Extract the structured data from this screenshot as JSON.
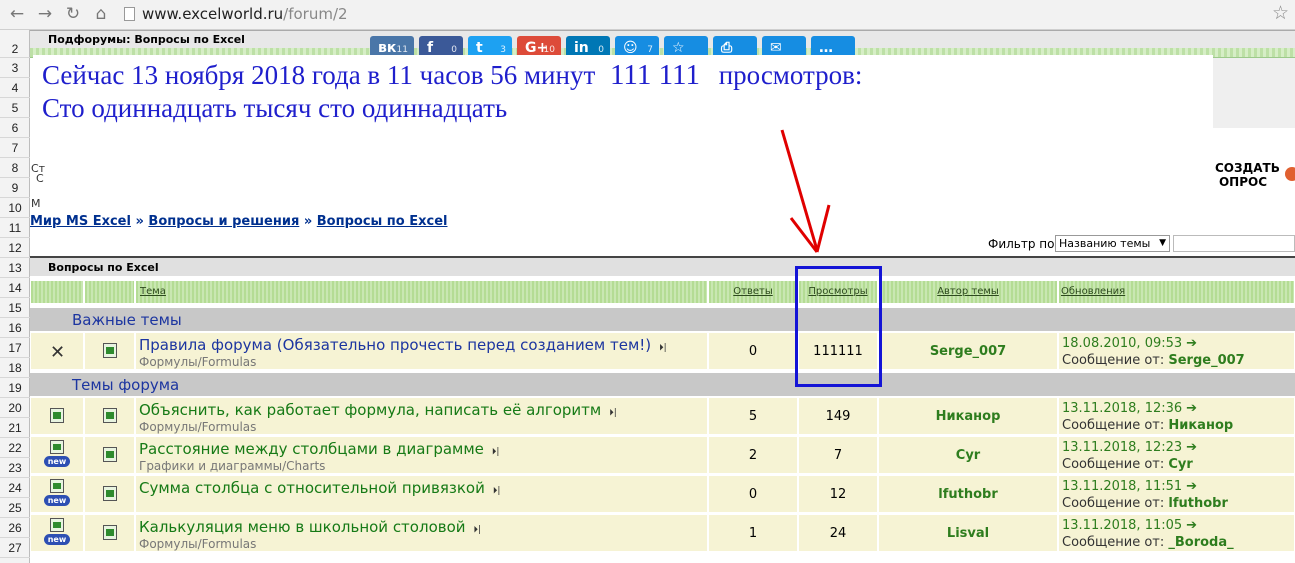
{
  "browser": {
    "url_host": "www.excelworld.ru",
    "url_path": "/forum/2"
  },
  "row_numbers": [
    "2",
    "3",
    "4",
    "5",
    "6",
    "7",
    "8",
    "9",
    "10",
    "11",
    "12",
    "13",
    "14",
    "15",
    "16",
    "17",
    "18",
    "19",
    "20",
    "21",
    "22",
    "23",
    "24",
    "25",
    "26",
    "27"
  ],
  "subforums_label": "Подфорумы: Вопросы по Excel",
  "share": [
    {
      "icon": "vk-icon",
      "glyph": "вк",
      "count": "11",
      "color": "#4a76a8"
    },
    {
      "icon": "facebook-icon",
      "glyph": "f",
      "count": "0",
      "color": "#3b5998"
    },
    {
      "icon": "twitter-icon",
      "glyph": "t",
      "count": "3",
      "color": "#1da1f2"
    },
    {
      "icon": "google-plus-icon",
      "glyph": "G+",
      "count": "10",
      "color": "#dd4b39"
    },
    {
      "icon": "linkedin-icon",
      "glyph": "in",
      "count": "0",
      "color": "#0077b5"
    },
    {
      "icon": "moymir-icon",
      "glyph": "☺",
      "count": "7",
      "color": "#168de2"
    },
    {
      "icon": "bookmark-icon",
      "glyph": "☆",
      "count": "",
      "color": "#168de2"
    },
    {
      "icon": "print-icon",
      "glyph": "⎙",
      "count": "",
      "color": "#168de2"
    },
    {
      "icon": "email-icon",
      "glyph": "✉",
      "count": "",
      "color": "#168de2"
    },
    {
      "icon": "more-icon",
      "glyph": "…",
      "count": "",
      "color": "#168de2"
    }
  ],
  "overlay": {
    "line1_a": "Сейчас 13 ноября 2018 года в 11 часов 56 минут",
    "line1_num": "111 111",
    "line1_b": "просмотров:",
    "line2": "Сто одиннадцать тысяч сто одиннадцать"
  },
  "fragments": {
    "row7": "Ст",
    "row9": "С",
    "row10": "М"
  },
  "create_poll_label": "СОЗДАТЬ ОПРОС",
  "breadcrumb": [
    "Мир MS Excel",
    "Вопросы и решения",
    "Вопросы по Excel"
  ],
  "breadcrumb_sep": "»",
  "filter": {
    "label": "Фильтр по:",
    "selected": "Названию темы"
  },
  "forum_title": "Вопросы по Excel",
  "columns": {
    "topic": "Тема",
    "replies": "Ответы",
    "views": "Просмотры",
    "author": "Автор темы",
    "updates": "Обновления"
  },
  "sections": {
    "important": "Важные темы",
    "forum": "Темы форума"
  },
  "pinned_topic": {
    "title": "Правила форума (Обязательно прочесть перед созданием тем!)",
    "category": "Формулы/Formulas",
    "replies": "0",
    "views": "111111",
    "author": "Serge_007",
    "updated": "18.08.2010, 09:53",
    "message_from_label": "Сообщение от:",
    "last_poster": "Serge_007"
  },
  "topics": [
    {
      "title": "Объяснить, как работает формула, написать её алгоритм",
      "category": "Формулы/Formulas",
      "replies": "5",
      "views": "149",
      "author": "Никанор",
      "updated": "13.11.2018, 12:36",
      "last_poster": "Никанор"
    },
    {
      "title": "Расстояние между столбцами в диаграмме",
      "category": "Графики и диаграммы/Charts",
      "replies": "2",
      "views": "7",
      "author": "Cyr",
      "updated": "13.11.2018, 12:23",
      "last_poster": "Cyr"
    },
    {
      "title": "Сумма столбца с относительной привязкой",
      "category": "",
      "replies": "0",
      "views": "12",
      "author": "lfuthobr",
      "updated": "13.11.2018, 11:51",
      "last_poster": "lfuthobr"
    },
    {
      "title": "Калькуляция меню в школьной столовой",
      "category": "Формулы/Formulas",
      "replies": "1",
      "views": "24",
      "author": "Lisval",
      "updated": "13.11.2018, 11:05",
      "last_poster": "_Boroda_"
    }
  ],
  "message_from_label": "Сообщение от:",
  "new_badge": "new",
  "colors": {
    "overlay_text": "#1f1fcc",
    "highlight_box": "#1414d6",
    "arrow": "#e00000",
    "link": "#00308f",
    "green_text": "#2e7d1e"
  }
}
